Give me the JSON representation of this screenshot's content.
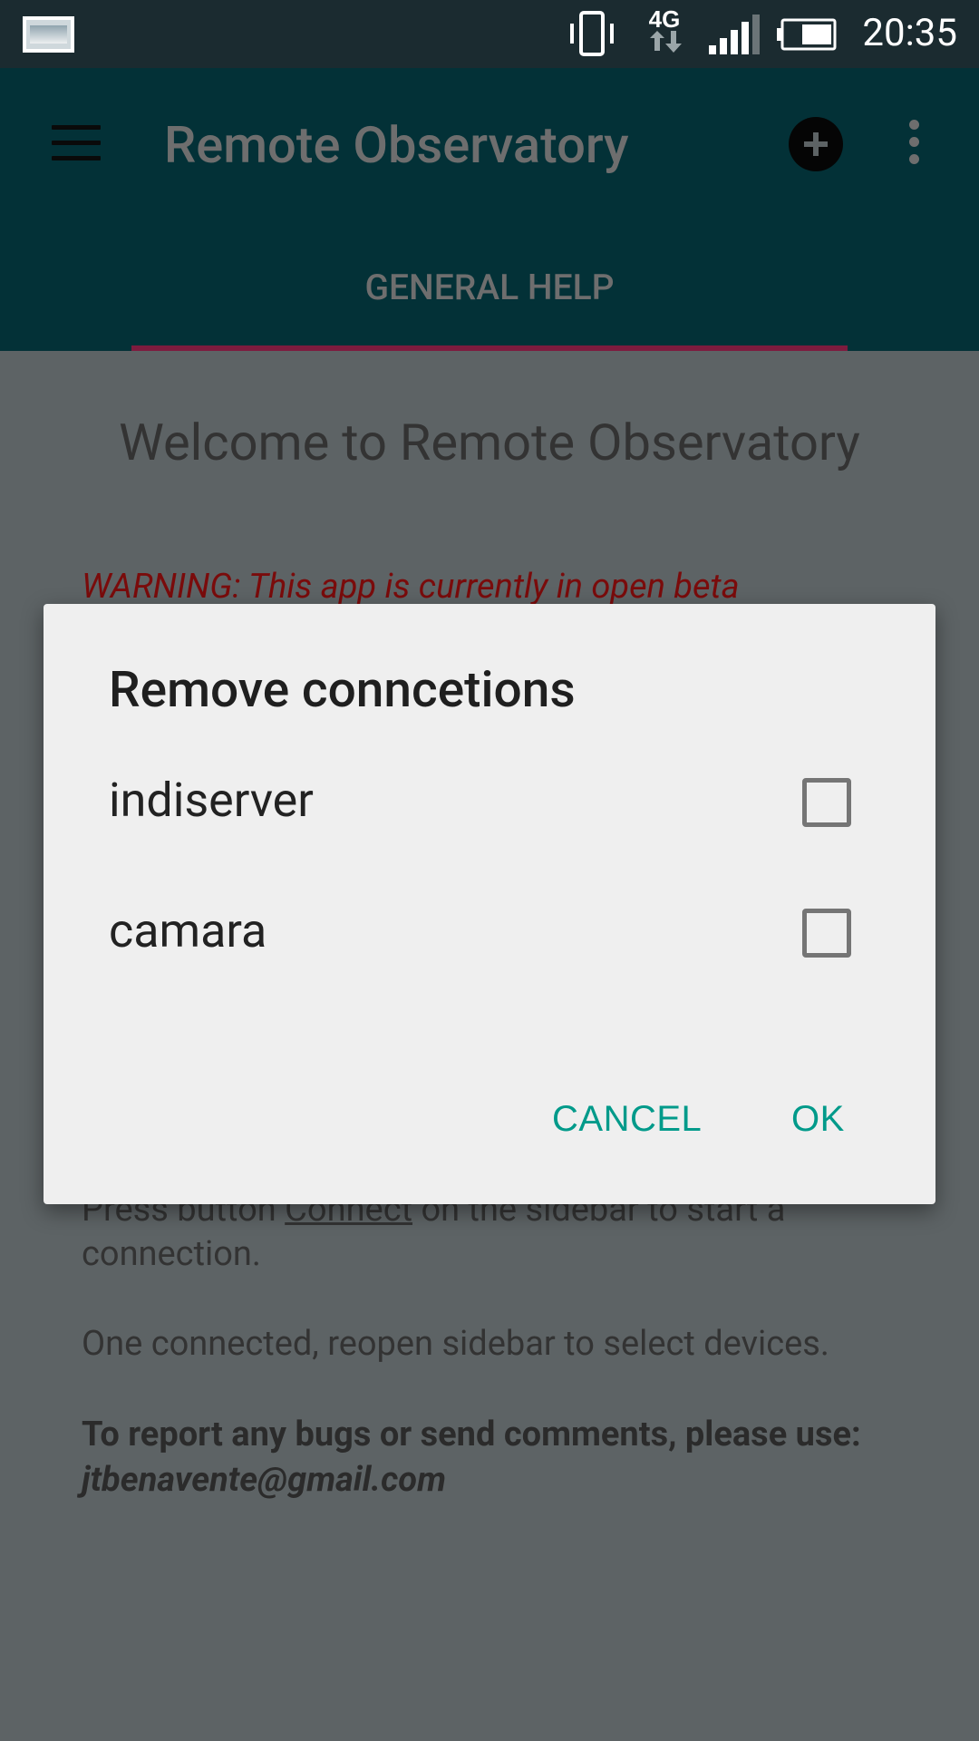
{
  "status_bar": {
    "time": "20:35",
    "icons": [
      "image-notification-icon",
      "vibrate-icon",
      "4g-icon",
      "signal-icon",
      "battery-icon"
    ],
    "network_label": "4G"
  },
  "app_bar": {
    "title": "Remote Observatory",
    "tab_label": "GENERAL HELP",
    "accent_color": "#7d1b3e",
    "background_color": "#033137"
  },
  "content": {
    "welcome": "Welcome to Remote Observatory",
    "warning": "WARNING: This app is currently in open beta",
    "press_prefix": "Press button ",
    "press_link": "Connect",
    "press_suffix": " on the sidebar to start a connection.",
    "once_connected": "One connected, reopen sidebar to select devices.",
    "report_prefix": "To report any bugs or send comments, please use: ",
    "report_email": "jtbenavente@gmail.com"
  },
  "dialog": {
    "title": "Remove conncetions",
    "options": [
      {
        "label": "indiserver",
        "checked": false
      },
      {
        "label": "camara",
        "checked": false
      }
    ],
    "cancel_label": "CANCEL",
    "ok_label": "OK",
    "button_color": "#009a8a"
  }
}
